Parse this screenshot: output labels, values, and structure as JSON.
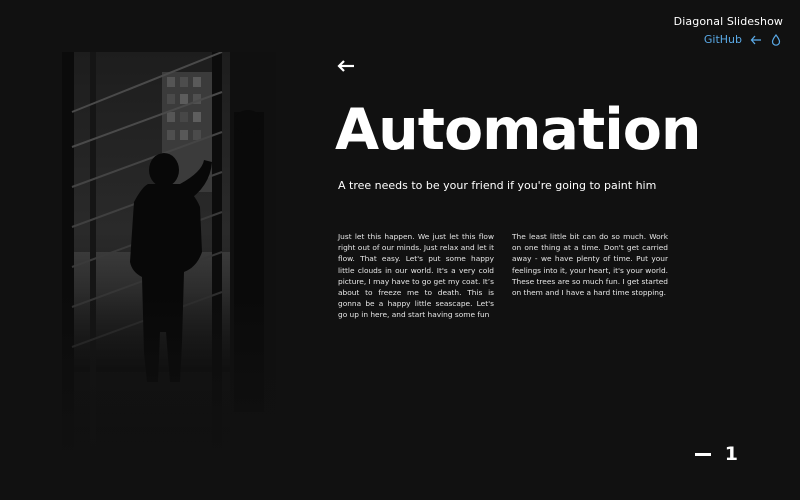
{
  "header": {
    "site_title": "Diagonal Slideshow",
    "github_label": "GitHub",
    "back_icon": "arrow-left-icon",
    "drop_icon": "drop-icon",
    "link_color": "#5aa9e6"
  },
  "slide": {
    "title": "Automation",
    "subtitle": "A tree needs to be your friend if you're going to paint him",
    "column_1": "Just let this happen. We just let this flow right out of our minds. Just relax and let it flow. That easy. Let's put some happy little clouds in our world. It's a very cold picture, I may have to go get my coat. It’s about to freeze me to death. This is gonna be a happy little seascape. Let's go up in here, and start having some fun",
    "column_2": "The least little bit can do so much. Work on one thing at a time. Don't get carried away - we have plenty of time. Put your feelings into it, your heart, it's your world. These trees are so much fun. I get started on them and I have a hard time stopping.",
    "nav_icon": "arrow-left-icon"
  },
  "counter": {
    "current": "1"
  },
  "colors": {
    "background": "#111111",
    "text": "#ffffff"
  }
}
